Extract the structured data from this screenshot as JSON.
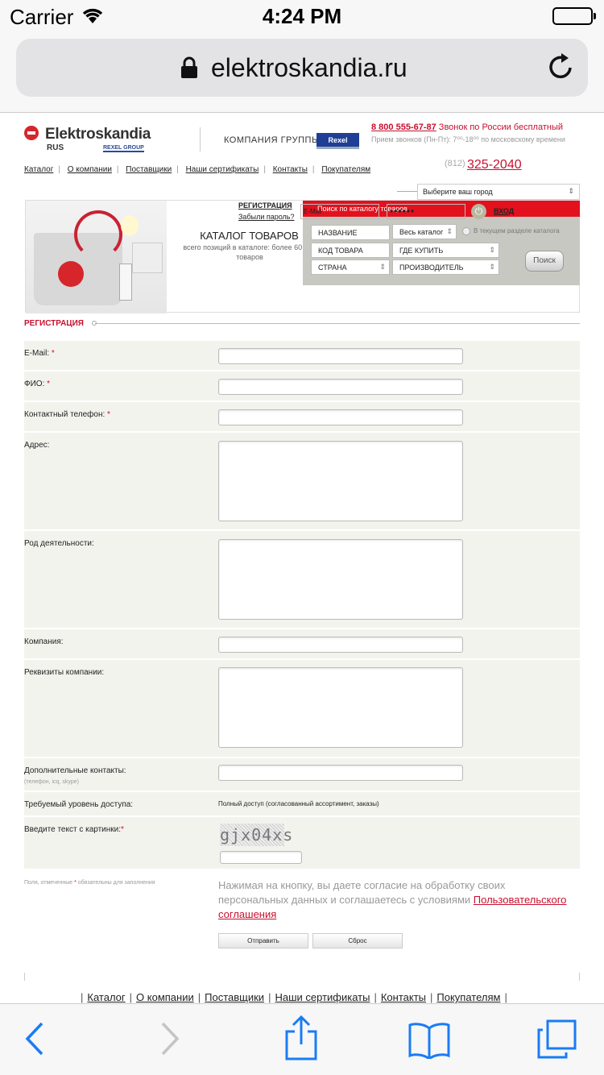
{
  "status_bar": {
    "carrier": "Carrier",
    "time": "4:24 PM"
  },
  "browser": {
    "url": "elektroskandia.ru"
  },
  "header": {
    "logo_name": "Elektroskandia",
    "logo_region": "RUS",
    "logo_group": "REXEL GROUP",
    "company_group": "КОМПАНИЯ  ГРУППЫ",
    "rexel_badge": "Rexel",
    "phone": "8 800 555-67-87",
    "phone_note": "Звонок по России бесплатный",
    "hours": "Прием звонков (Пн-Пт): 7⁰⁰-18⁰⁰ по московскому времени",
    "spb_code": "(812)",
    "spb_phone": "325-2040"
  },
  "top_nav": [
    "Каталог",
    "О компании",
    "Поставщики",
    "Наши сертификаты",
    "Контакты",
    "Покупателям"
  ],
  "city_select": "Выберите ваш город",
  "catalog": {
    "title": "КАТАЛОГ ТОВАРОВ",
    "subtitle": "всего позиций в каталоге: более 60 000 товаров",
    "search_head": "Поиск по каталогу товаров",
    "field_name": "НАЗВАНИЕ",
    "field_scope": "Весь каталог",
    "radio_label": "В текущем разделе каталога",
    "field_code": "КОД ТОВАРА",
    "field_where": "ГДЕ КУПИТЬ",
    "field_country": "СТРАНА",
    "field_maker": "ПРОИЗВОДИТЕЛЬ",
    "search_button": "Поиск"
  },
  "login": {
    "register_link": "РЕГИСТРАЦИЯ",
    "forgot_link": "Забыли пароль?",
    "email_placeholder": "E-Mail",
    "password_value": "••••••",
    "enter_link": "ВХОД"
  },
  "registration": {
    "title": "РЕГИСТРАЦИЯ",
    "email_label": "E-Mail:",
    "fio_label": "ФИО:",
    "phone_label": "Контактный телефон:",
    "address_label": "Адрес:",
    "activity_label": "Род деятельности:",
    "company_label": "Компания:",
    "requisites_label": "Реквизиты компании:",
    "extra_contacts_label": "Дополнительные контакты:",
    "extra_contacts_hint": "(телефон, icq, skype)",
    "access_label": "Требуемый уровень доступа:",
    "access_value": "Полный доступ (согласованный ассортимент, заказы)",
    "captcha_label": "Введите текст с картинки:",
    "captcha_text": "gjx04xs",
    "required_mark": "*",
    "required_note_a": "Поля, отмеченные",
    "required_note_b": "обязательны для заполнения",
    "consent_text": "Нажимая на кнопку, вы даете согласие на обработку своих персональных данных и соглашаетесь с условиями",
    "consent_link": "Пользовательского соглашения",
    "submit_button": "Отправить",
    "reset_button": "Сброс"
  },
  "footer_nav": [
    "Каталог",
    "О компании",
    "Поставщики",
    "Наши сертификаты",
    "Контакты",
    "Покупателям"
  ],
  "colors": {
    "brand_red": "#c8102e",
    "ios_blue": "#1a7cf5"
  },
  "toolbar_icons": [
    "back-icon",
    "forward-icon",
    "share-icon",
    "bookmarks-icon",
    "tabs-icon"
  ]
}
